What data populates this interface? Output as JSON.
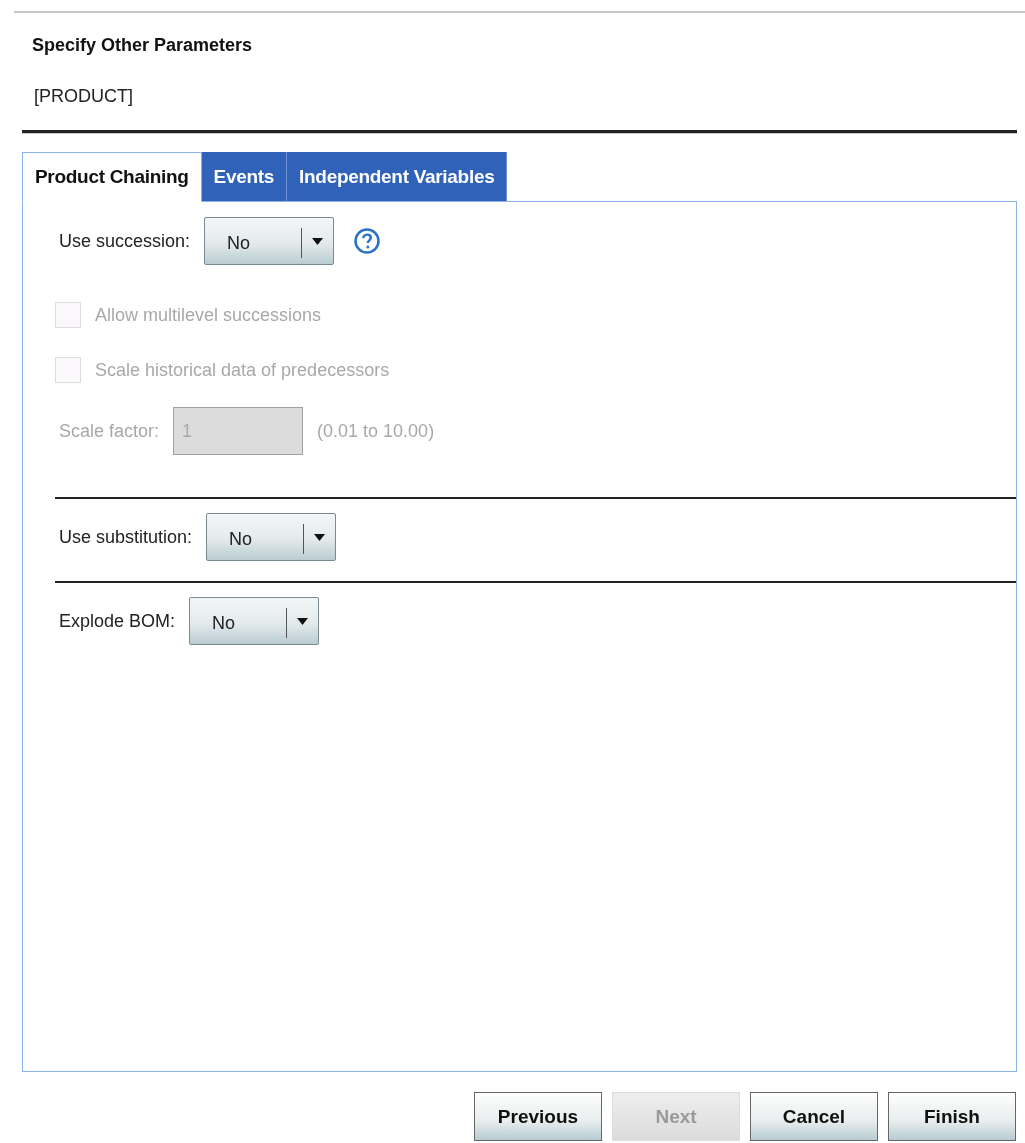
{
  "title": "Specify Other Parameters",
  "subtitle": "[PRODUCT]",
  "tabs": [
    {
      "label": "Product Chaining",
      "selected": true
    },
    {
      "label": "Events",
      "selected": false
    },
    {
      "label": "Independent Variables",
      "selected": false
    }
  ],
  "sections": [
    {
      "rows": [
        {
          "kind": "dropdown",
          "label": "Use succession:",
          "value": "No",
          "help": true
        },
        {
          "kind": "checkbox",
          "label": "Allow multilevel successions",
          "checked": false,
          "disabled": true
        },
        {
          "kind": "checkbox",
          "label": "Scale historical data of predecessors",
          "checked": false,
          "disabled": true
        },
        {
          "kind": "number",
          "label": "Scale factor:",
          "value": "1",
          "hint": "(0.01 to 10.00)",
          "disabled": true
        }
      ]
    },
    {
      "rows": [
        {
          "kind": "dropdown",
          "label": "Use substitution:",
          "value": "No",
          "help": false
        }
      ]
    },
    {
      "rows": [
        {
          "kind": "dropdown",
          "label": "Explode BOM:",
          "value": "No",
          "help": false
        }
      ]
    }
  ],
  "buttons": [
    {
      "label": "Previous",
      "disabled": false
    },
    {
      "label": "Next",
      "disabled": true
    },
    {
      "label": "Cancel",
      "disabled": false
    },
    {
      "label": "Finish",
      "disabled": false
    }
  ]
}
